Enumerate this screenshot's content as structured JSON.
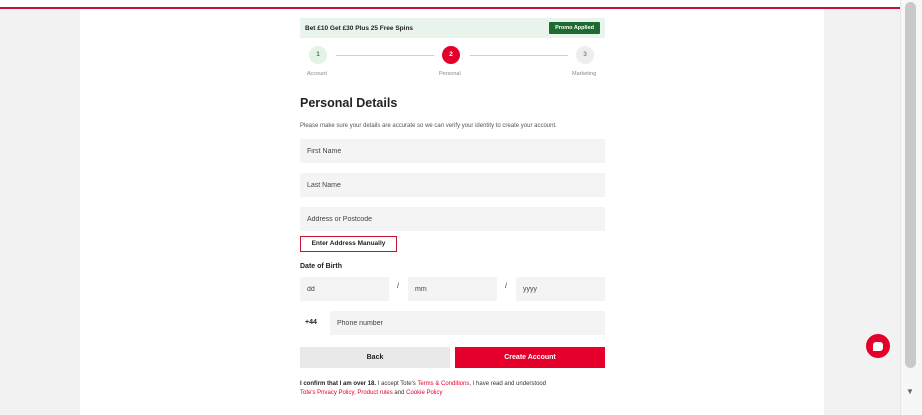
{
  "promo": {
    "text": "Bet £10 Get £30 Plus 25 Free Spins",
    "badge": "Promo Applied"
  },
  "stepper": {
    "steps": [
      {
        "number": "1",
        "label": "Account",
        "state": "done"
      },
      {
        "number": "2",
        "label": "Personal",
        "state": "active"
      },
      {
        "number": "3",
        "label": "Marketing",
        "state": "pending"
      }
    ]
  },
  "form": {
    "title": "Personal Details",
    "subtitle": "Please make sure your details are accurate so we can verify your identity to create your account.",
    "first_name_placeholder": "First Name",
    "last_name_placeholder": "Last Name",
    "address_placeholder": "Address or Postcode",
    "manual_address_label": "Enter Address Manually",
    "dob_label": "Date of Birth",
    "dob_day_placeholder": "dd",
    "dob_month_placeholder": "mm",
    "dob_year_placeholder": "yyyy",
    "dob_separator": "/",
    "phone_prefix": "+44",
    "phone_placeholder": "Phone number",
    "back_label": "Back",
    "create_label": "Create Account"
  },
  "legal": {
    "bold": "I confirm that I am over 18.",
    "text1": " I accept Tote's ",
    "link_terms": "Terms & Conditions",
    "text2": ", I have read and understood ",
    "link_privacy": "Tote's Privacy Policy",
    "text3": ", ",
    "link_product": "Product rules",
    "text4": " and ",
    "link_cookie": "Cookie Policy"
  },
  "colors": {
    "brand_red": "#e4002b",
    "promo_green": "#1d6b2f",
    "promo_bg": "#e9f4ec",
    "field_bg": "#f4f4f4"
  },
  "icons": {
    "chat": "chat-icon",
    "scroll_down": "scroll-down-arrow-icon"
  }
}
